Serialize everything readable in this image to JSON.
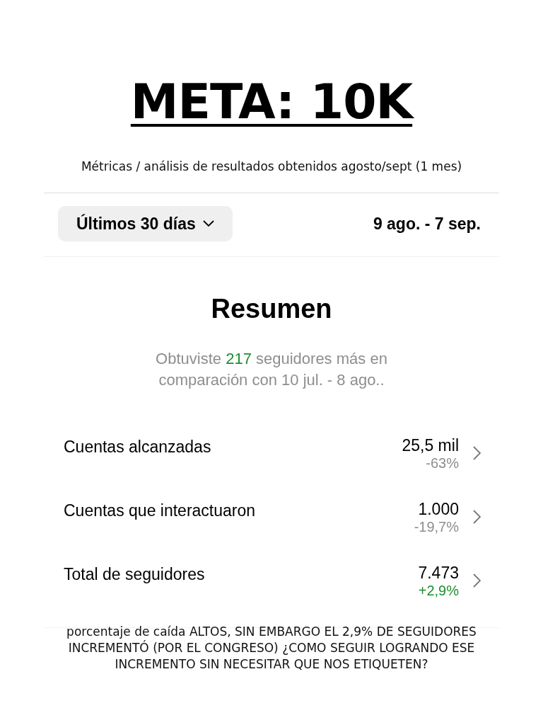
{
  "title": "META: 10K",
  "subtitle": "Métricas / análisis de resultados obtenidos agosto/sept (1 mes)",
  "range": {
    "label": "Últimos 30 días",
    "dates": "9 ago. - 7 sep."
  },
  "summary": {
    "heading": "Resumen",
    "before": "Obtuviste ",
    "highlight": "217",
    "after": " seguidores más en comparación con 10 jul. - 8 ago.."
  },
  "metrics": [
    {
      "label": "Cuentas alcanzadas",
      "value": "25,5 mil",
      "change": "-63%",
      "color": "#8e8e8e"
    },
    {
      "label": "Cuentas que interactuaron",
      "value": "1.000",
      "change": "-19,7%",
      "color": "#8e8e8e"
    },
    {
      "label": "Total de seguidores",
      "value": "7.473",
      "change": "+2,9%",
      "color": "#1a8f2e"
    }
  ],
  "note": "porcentaje de caída ALTOS, SIN EMBARGO EL 2,9% DE SEGUIDORES INCREMENTÓ (POR EL CONGRESO) ¿COMO SEGUIR LOGRANDO ESE INCREMENTO SIN NECESITAR QUE NOS ETIQUETEN?"
}
